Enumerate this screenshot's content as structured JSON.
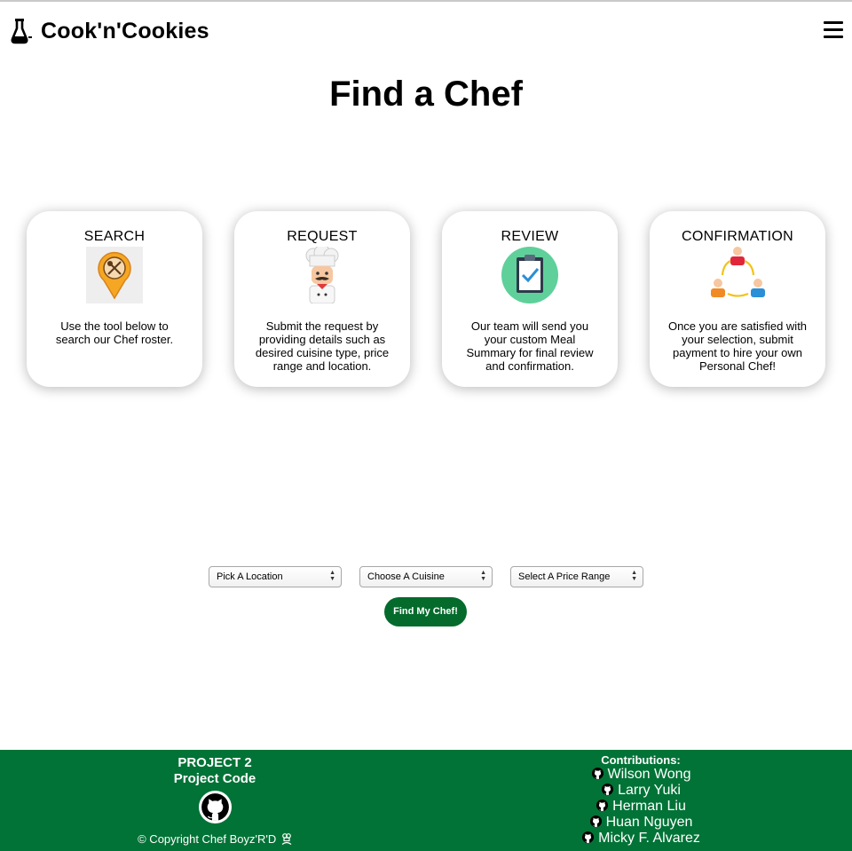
{
  "brand": {
    "name": "Cook'n'Cookies",
    "icon": "flask-icon"
  },
  "menu": {
    "icon": "hamburger-menu-icon"
  },
  "page_title": "Find a Chef",
  "steps": [
    {
      "title": "SEARCH",
      "icon": "map-pin-utensils-icon",
      "text": "Use the tool below to search our Chef roster."
    },
    {
      "title": "REQUEST",
      "icon": "chef-icon",
      "text": "Submit the request by providing details such as desired cuisine type, price range and location."
    },
    {
      "title": "REVIEW",
      "icon": "clipboard-check-icon",
      "text": "Our team will send you your custom Meal Summary for final review and confirmation."
    },
    {
      "title": "CONFIRMATION",
      "icon": "people-cycle-icon",
      "text": "Once you are satisfied with your selection, submit payment to hire your own Personal Chef!"
    }
  ],
  "search_form": {
    "location_select": "Pick A Location",
    "cuisine_select": "Choose A Cuisine",
    "price_select": "Select A Price Range",
    "submit_label": "Find My Chef!"
  },
  "footer": {
    "project_title": "PROJECT 2",
    "project_code_label": "Project Code",
    "copyright": "© Copyright Chef Boyz'R'D",
    "contributions_title": "Contributions:",
    "contributors": [
      "Wilson Wong",
      "Larry Yuki",
      "Herman Liu",
      "Huan Nguyen",
      "Micky F. Alvarez"
    ],
    "colors": {
      "footer_bg": "#017336",
      "button_bg": "#046b2c"
    }
  }
}
